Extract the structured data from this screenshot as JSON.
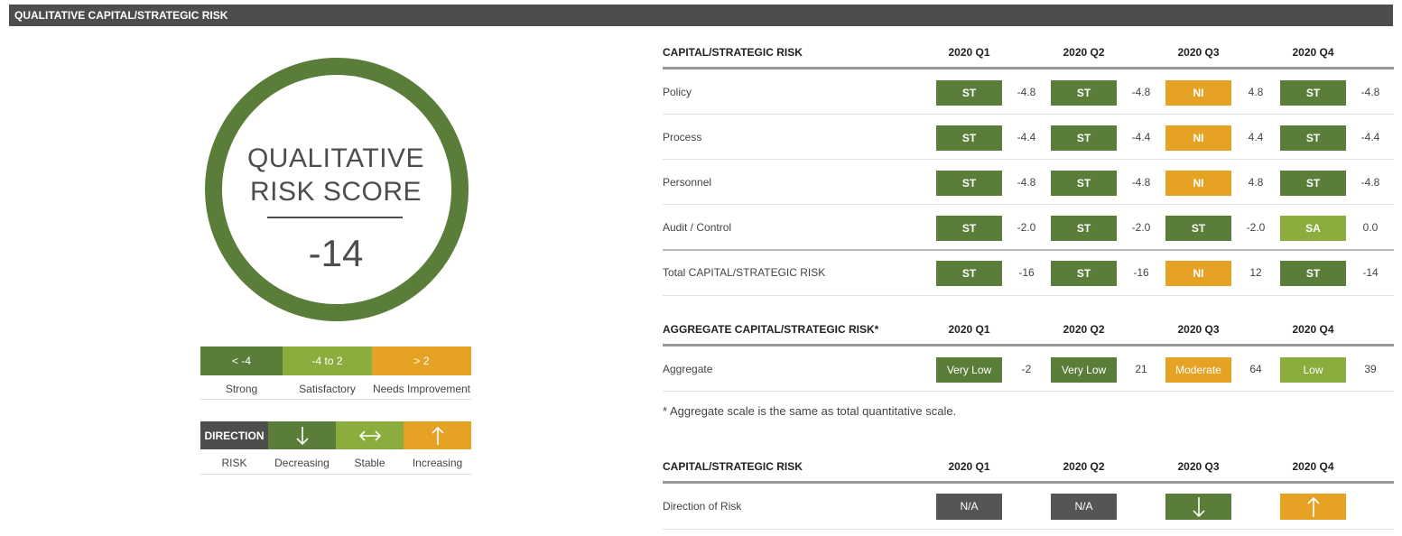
{
  "header": {
    "title": "QUALITATIVE CAPITAL/STRATEGIC RISK"
  },
  "score": {
    "title_line1": "QUALITATIVE",
    "title_line2": "RISK SCORE",
    "value": "-14"
  },
  "legend": {
    "ranges": [
      "< -4",
      "-4 to 2",
      "> 2"
    ],
    "labels": [
      "Strong",
      "Satisfactory",
      "Needs Improvement"
    ]
  },
  "direction_legend": {
    "header": "DIRECTION",
    "risk_label": "RISK",
    "labels": [
      "Decreasing",
      "Stable",
      "Increasing"
    ],
    "icons": [
      "arrow-down-icon",
      "arrow-left-right-icon",
      "arrow-up-icon"
    ]
  },
  "colors": {
    "strong": "#5a7d3a",
    "satisfactory": "#8aad3e",
    "needs_improvement": "#e5a224",
    "neutral": "#4d4d4d"
  },
  "table1": {
    "title": "CAPITAL/STRATEGIC RISK",
    "quarters": [
      "2020 Q1",
      "2020 Q2",
      "2020 Q3",
      "2020 Q4"
    ],
    "rows": [
      {
        "label": "Policy",
        "cells": [
          [
            "ST",
            "-4.8"
          ],
          [
            "ST",
            "-4.8"
          ],
          [
            "NI",
            "4.8"
          ],
          [
            "ST",
            "-4.8"
          ]
        ]
      },
      {
        "label": "Process",
        "cells": [
          [
            "ST",
            "-4.4"
          ],
          [
            "ST",
            "-4.4"
          ],
          [
            "NI",
            "4.4"
          ],
          [
            "ST",
            "-4.4"
          ]
        ]
      },
      {
        "label": "Personnel",
        "cells": [
          [
            "ST",
            "-4.8"
          ],
          [
            "ST",
            "-4.8"
          ],
          [
            "NI",
            "4.8"
          ],
          [
            "ST",
            "-4.8"
          ]
        ]
      },
      {
        "label": "Audit / Control",
        "cells": [
          [
            "ST",
            "-2.0"
          ],
          [
            "ST",
            "-2.0"
          ],
          [
            "ST",
            "-2.0"
          ],
          [
            "SA",
            "0.0"
          ]
        ]
      },
      {
        "label": "Total CAPITAL/STRATEGIC RISK",
        "cells": [
          [
            "ST",
            "-16"
          ],
          [
            "ST",
            "-16"
          ],
          [
            "NI",
            "12"
          ],
          [
            "ST",
            "-14"
          ]
        ]
      }
    ]
  },
  "table2": {
    "title": "AGGREGATE CAPITAL/STRATEGIC RISK*",
    "quarters": [
      "2020 Q1",
      "2020 Q2",
      "2020 Q3",
      "2020 Q4"
    ],
    "rows": [
      {
        "label": "Aggregate",
        "cells": [
          [
            "Very Low",
            "-2"
          ],
          [
            "Very Low",
            "21"
          ],
          [
            "Moderate",
            "64"
          ],
          [
            "Low",
            "39"
          ]
        ]
      }
    ],
    "footnote": "* Aggregate scale is the same as total quantitative scale."
  },
  "table3": {
    "title": "CAPITAL/STRATEGIC RISK",
    "quarters": [
      "2020 Q1",
      "2020 Q2",
      "2020 Q3",
      "2020 Q4"
    ],
    "rows": [
      {
        "label": "Direction of Risk",
        "cells": [
          "N/A",
          "N/A",
          "arrow-down-icon",
          "arrow-up-icon"
        ]
      }
    ]
  }
}
